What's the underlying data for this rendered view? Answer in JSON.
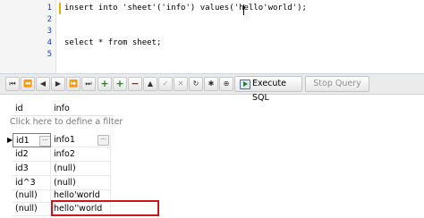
{
  "editor": {
    "line_numbers": [
      "1",
      "2",
      "3",
      "4",
      "5"
    ],
    "lines": [
      "insert into 'sheet'('info') values('hello'world');",
      "",
      "",
      "select * from sheet;",
      ""
    ]
  },
  "toolbar": {
    "icons": [
      {
        "name": "first-record-icon",
        "glyph": "⏮"
      },
      {
        "name": "prev-page-icon",
        "glyph": "⏪"
      },
      {
        "name": "prev-record-icon",
        "glyph": "◀"
      },
      {
        "name": "next-record-icon",
        "glyph": "▶"
      },
      {
        "name": "next-page-icon",
        "glyph": "⏩"
      },
      {
        "name": "last-record-icon",
        "glyph": "⏭"
      },
      {
        "name": "add-record-icon",
        "glyph": "+"
      },
      {
        "name": "add-multiple-records-icon",
        "glyph": "+"
      },
      {
        "name": "delete-record-icon",
        "glyph": "−"
      },
      {
        "name": "move-up-icon",
        "glyph": "▲"
      },
      {
        "name": "confirm-icon",
        "glyph": "✓"
      },
      {
        "name": "cancel-icon",
        "glyph": "✕"
      },
      {
        "name": "refresh-icon",
        "glyph": "↻"
      },
      {
        "name": "asterisk-icon",
        "glyph": "✱"
      },
      {
        "name": "filter-icon",
        "glyph": "⊕"
      }
    ],
    "execute_label": "Execute SQL",
    "stop_label": "Stop Query"
  },
  "grid": {
    "columns": [
      "id",
      "info"
    ],
    "filter_placeholder": "Click here to define a filter",
    "current_row_indicator": "▶",
    "rows": [
      {
        "id": "id1",
        "info": "info1"
      },
      {
        "id": "id2",
        "info": "info2"
      },
      {
        "id": "id3",
        "info": "(null)"
      },
      {
        "id": "id^3",
        "info": "(null)"
      },
      {
        "id": "(null)",
        "info": "hello'world"
      },
      {
        "id": "(null)",
        "info": "hello''world"
      }
    ]
  },
  "colors": {
    "line_number": "#1a44b0",
    "highlight_border": "#d0141d",
    "toolbar_bg": "#ebebeb",
    "current_line_marker": "#e8b000"
  }
}
